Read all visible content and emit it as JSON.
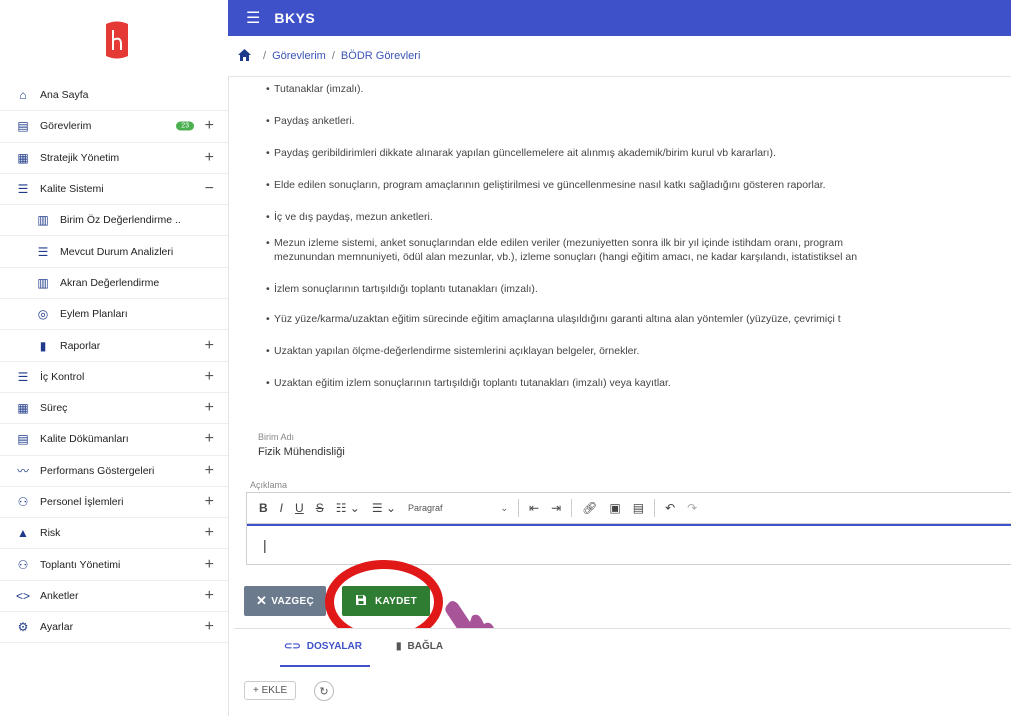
{
  "app": {
    "title": "BKYS"
  },
  "breadcrumb": [
    "Görevlerim",
    "BÖDR Görevleri"
  ],
  "sidebar": {
    "items": [
      {
        "label": "Ana Sayfa",
        "icon": "home-icon",
        "plus": ""
      },
      {
        "label": "Görevlerim",
        "icon": "task-icon",
        "plus": "+",
        "badge": "23"
      },
      {
        "label": "Stratejik Yönetim",
        "icon": "sitemap-icon",
        "plus": "+"
      },
      {
        "label": "Kalite Sistemi",
        "icon": "list-icon",
        "plus": "−"
      },
      {
        "label": "Birim Öz Değerlendirme ..",
        "icon": "clipboard-icon",
        "plus": "",
        "sub": true
      },
      {
        "label": "Mevcut Durum Analizleri",
        "icon": "list-icon",
        "plus": "",
        "sub": true
      },
      {
        "label": "Akran Değerlendirme",
        "icon": "clipboard-icon",
        "plus": "",
        "sub": true
      },
      {
        "label": "Eylem Planları",
        "icon": "check-circle-icon",
        "plus": "",
        "sub": true
      },
      {
        "label": "Raporlar",
        "icon": "book-icon",
        "plus": "+",
        "sub": true
      },
      {
        "label": "İç Kontrol",
        "icon": "list-icon",
        "plus": "+"
      },
      {
        "label": "Süreç",
        "icon": "sitemap-icon",
        "plus": "+"
      },
      {
        "label": "Kalite Dökümanları",
        "icon": "document-icon",
        "plus": "+"
      },
      {
        "label": "Performans Göstergeleri",
        "icon": "chart-line-icon",
        "plus": "+"
      },
      {
        "label": "Personel İşlemleri",
        "icon": "people-icon",
        "plus": "+"
      },
      {
        "label": "Risk",
        "icon": "warning-icon",
        "plus": "+"
      },
      {
        "label": "Toplantı Yönetimi",
        "icon": "meeting-icon",
        "plus": "+"
      },
      {
        "label": "Anketler",
        "icon": "code-icon",
        "plus": "+"
      },
      {
        "label": "Ayarlar",
        "icon": "gear-icon",
        "plus": "+"
      }
    ]
  },
  "content": {
    "bullets": [
      [
        "Tutanaklar (imzalı)."
      ],
      [
        "Paydaş anketleri."
      ],
      [
        "Paydaş geribildirimleri dikkate alınarak yapılan güncellemelere ait alınmış akademik/birim kurul vb kararları)."
      ],
      [
        "Elde edilen sonuçların, program amaçlarının geliştirilmesi ve güncellenmesine nasıl katkı sağladığını gösteren raporlar."
      ],
      [
        "İç ve dış paydaş, mezun anketleri."
      ],
      [
        "Mezun izleme sistemi, anket sonuçlarından elde edilen veriler (mezuniyetten sonra ilk bir yıl içinde istihdam oranı, program",
        "mezunundan memnuniyeti, ödül alan mezunlar, vb.), izleme sonuçları (hangi eğitim amacı, ne kadar karşılandı, istatistiksel an"
      ],
      [
        "İzlem sonuçlarının tartışıldığı toplantı tutanakları (imzalı)."
      ],
      [
        "Yüz yüze/karma/uzaktan eğitim sürecinde eğitim amaçlarına ulaşıldığını garanti altına alan yöntemler (yüzyüze, çevrimiçi t"
      ],
      [
        "Uzaktan yapılan ölçme-değerlendirme sistemlerini açıklayan belgeler, örnekler."
      ],
      [
        "Uzaktan eğitim izlem sonuçlarının tartışıldığı toplantı tutanakları (imzalı) veya kayıtlar."
      ]
    ],
    "unit_label": "Birim Adı",
    "unit_value": "Fizik Mühendisliği",
    "desc_label": "Açıklama",
    "editor": {
      "paragraph": "Paragraf",
      "text": "|"
    }
  },
  "buttons": {
    "cancel": "VAZGEÇ",
    "save": "KAYDET"
  },
  "bottom": {
    "tab1": "DOSYALAR",
    "tab2": "BAĞLA",
    "add": "+ EKLE"
  },
  "colors": {
    "primary": "#3f51c8",
    "save": "#2e7d32",
    "highlight": "#e01818",
    "cancel": "#6b7a8c"
  }
}
